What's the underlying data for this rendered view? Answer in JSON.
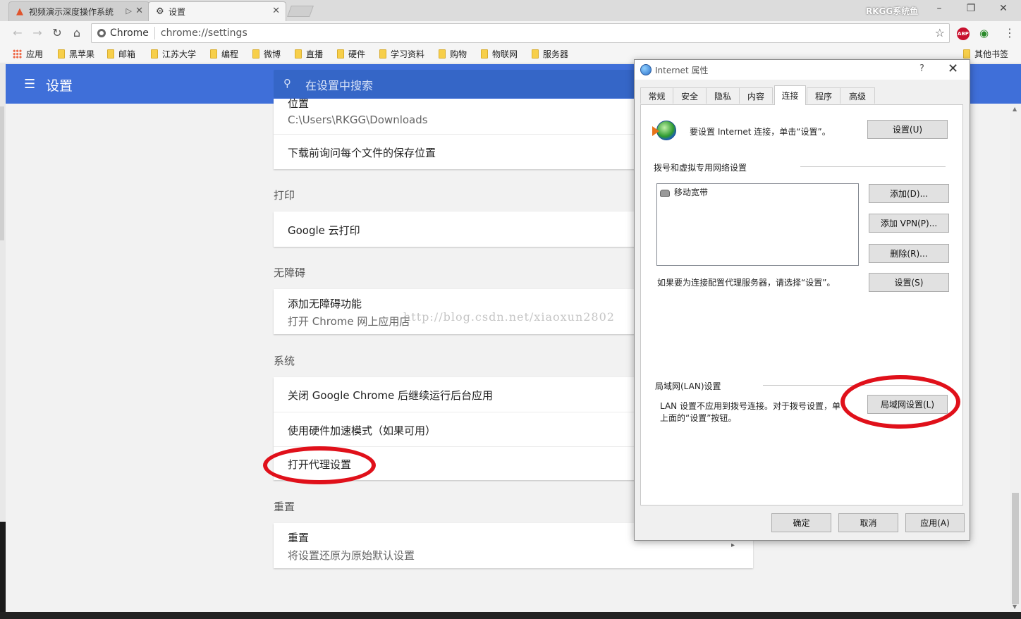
{
  "browser": {
    "tabs": [
      {
        "title": "视频演示深度操作系统",
        "icon": "flame-icon"
      },
      {
        "title": "设置",
        "icon": "gear-icon"
      }
    ],
    "window_user": "RKGG系统鱼",
    "address": {
      "chip": "Chrome",
      "url": "chrome://settings"
    },
    "extensions": {
      "abp": "ABP"
    },
    "bookmarks": [
      "应用",
      "黑苹果",
      "邮箱",
      "江苏大学",
      "编程",
      "微博",
      "直播",
      "硬件",
      "学习资料",
      "购物",
      "物联网",
      "服务器"
    ],
    "other_bookmarks": "其他书签"
  },
  "settings": {
    "title": "设置",
    "search_placeholder": "在设置中搜索",
    "downloads": {
      "location_label": "位置",
      "location_value": "C:\\Users\\RKGG\\Downloads",
      "ask_label": "下载前询问每个文件的保存位置"
    },
    "print": {
      "header": "打印",
      "cloud_print": "Google 云打印"
    },
    "accessibility": {
      "header": "无障碍",
      "add_label": "添加无障碍功能",
      "add_sub": "打开 Chrome 网上应用店"
    },
    "system": {
      "header": "系统",
      "background_apps": "关闭 Google Chrome 后继续运行后台应用",
      "hardware_accel": "使用硬件加速模式（如果可用）",
      "proxy": "打开代理设置"
    },
    "reset": {
      "header": "重置",
      "label": "重置",
      "sub": "将设置还原为原始默认设置"
    },
    "watermark": "http://blog.csdn.net/xiaoxun2802"
  },
  "dialog": {
    "title": "Internet 属性",
    "help": "?",
    "tabs": [
      "常规",
      "安全",
      "隐私",
      "内容",
      "连接",
      "程序",
      "高级"
    ],
    "selected_tab": "连接",
    "setup_text": "要设置 Internet 连接，单击“设置”。",
    "setup_button": "设置(U)",
    "dialup_header": "拨号和虚拟专用网络设置",
    "connections": [
      "移动宽带"
    ],
    "add_button": "添加(D)...",
    "add_vpn_button": "添加 VPN(P)...",
    "remove_button": "删除(R)...",
    "proxy_text": "如果要为连接配置代理服务器，请选择“设置”。",
    "settings_button": "设置(S)",
    "lan_header": "局域网(LAN)设置",
    "lan_text_1": "LAN 设置不应用到拨号连接。对于拨号设置，单",
    "lan_text_2": "上面的“设置”按钮。",
    "lan_button": "局域网设置(L)",
    "ok_button": "确定",
    "cancel_button": "取消",
    "apply_button": "应用(A)"
  },
  "annotation_color": "#e0101a"
}
